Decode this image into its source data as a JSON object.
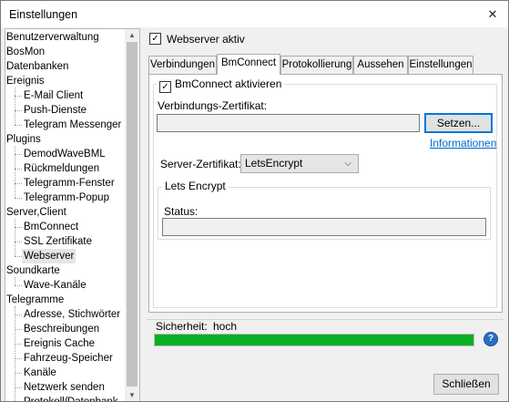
{
  "window": {
    "title": "Einstellungen",
    "close_glyph": "✕"
  },
  "tree": {
    "items": [
      {
        "label": "Benutzerverwaltung",
        "level": 0
      },
      {
        "label": "BosMon",
        "level": 0
      },
      {
        "label": "Datenbanken",
        "level": 0
      },
      {
        "label": "Ereignis",
        "level": 0
      },
      {
        "label": "E-Mail Client",
        "level": 1
      },
      {
        "label": "Push-Dienste",
        "level": 1
      },
      {
        "label": "Telegram Messenger",
        "level": 1
      },
      {
        "label": "Plugins",
        "level": 0
      },
      {
        "label": "DemodWaveBML",
        "level": 1
      },
      {
        "label": "Rückmeldungen",
        "level": 1
      },
      {
        "label": "Telegramm-Fenster",
        "level": 1
      },
      {
        "label": "Telegramm-Popup",
        "level": 1
      },
      {
        "label": "Server,Client",
        "level": 0
      },
      {
        "label": "BmConnect",
        "level": 1
      },
      {
        "label": "SSL Zertifikate",
        "level": 1
      },
      {
        "label": "Webserver",
        "level": 1,
        "selected": true
      },
      {
        "label": "Soundkarte",
        "level": 0
      },
      {
        "label": "Wave-Kanäle",
        "level": 1
      },
      {
        "label": "Telegramme",
        "level": 0
      },
      {
        "label": "Adresse, Stichwörter",
        "level": 1
      },
      {
        "label": "Beschreibungen",
        "level": 1
      },
      {
        "label": "Ereignis Cache",
        "level": 1
      },
      {
        "label": "Fahrzeug-Speicher",
        "level": 1
      },
      {
        "label": "Kanäle",
        "level": 1
      },
      {
        "label": "Netzwerk senden",
        "level": 1
      },
      {
        "label": "Protokoll/Datenbank",
        "level": 1
      }
    ],
    "scroll_up": "▲",
    "scroll_down": "▼"
  },
  "webserver": {
    "checkbox_label": "Webserver aktiv",
    "checked": true,
    "check_glyph": "✓"
  },
  "tabs": [
    {
      "label": "Verbindungen"
    },
    {
      "label": "BmConnect",
      "active": true
    },
    {
      "label": "Protokollierung"
    },
    {
      "label": "Aussehen"
    },
    {
      "label": "Einstellungen"
    }
  ],
  "bmconnect": {
    "activate_label": "BmConnect aktivieren",
    "checked": true,
    "cert_label": "Verbindungs-Zertifikat:",
    "cert_value": "",
    "set_button": "Setzen...",
    "info_link": "Informationen",
    "server_cert_label": "Server-Zertifikat:",
    "server_cert_value": "LetsEncrypt",
    "letsencrypt": {
      "group_title": "Lets Encrypt",
      "status_label": "Status:",
      "status_value": ""
    }
  },
  "security": {
    "label": "Sicherheit:",
    "value": "hoch",
    "level_percent": 100,
    "bar_color": "#06b025"
  },
  "footer": {
    "close_button": "Schließen"
  }
}
